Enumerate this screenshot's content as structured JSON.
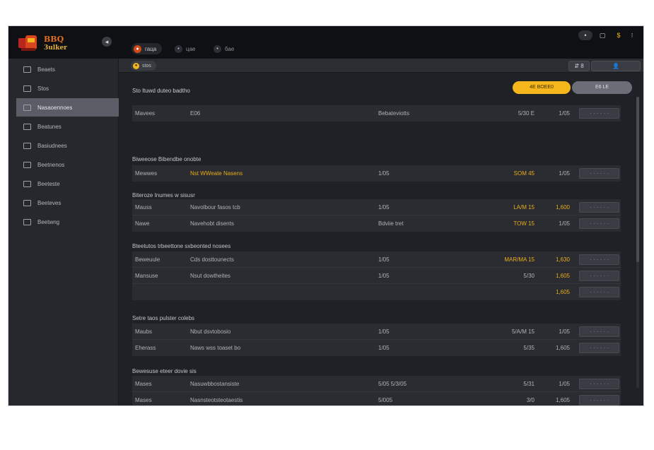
{
  "app": {
    "logo_line1": "BBQ",
    "logo_line2": "3ulker",
    "collapse_glyph": "◂"
  },
  "top_tabs": [
    {
      "label": "гаца",
      "icon": "flame-icon"
    },
    {
      "label": "цае",
      "icon": "dot-icon"
    },
    {
      "label": "бае",
      "icon": "dot-icon"
    }
  ],
  "window_controls": {
    "notif_count": "•",
    "win1": "▢",
    "win2": "$",
    "win3": "⁝"
  },
  "sidebar": {
    "items": [
      {
        "label": "Beaets",
        "icon": "grid-icon"
      },
      {
        "label": "Stos",
        "icon": "square-icon"
      },
      {
        "label": "Nasaoennoes",
        "icon": "square-icon"
      },
      {
        "label": "Beatunes",
        "icon": "table-icon"
      },
      {
        "label": "Basiudnees",
        "icon": "bag-icon"
      },
      {
        "label": "Beetnenos",
        "icon": "list-icon"
      },
      {
        "label": "Beeteste",
        "icon": "sliders-icon"
      },
      {
        "label": "Beeteves",
        "icon": "box-icon"
      },
      {
        "label": "Beetwng",
        "icon": "file-icon"
      }
    ],
    "active_index": 2
  },
  "subbar": {
    "chip_label": "stos",
    "chip_icon": "coin-icon",
    "btn1": "⇵ 8",
    "btn2": "👤"
  },
  "main": {
    "title": "Sto ltuwd duteo badtho",
    "primary_button": "4E BOEE0",
    "secondary_button": "E6 LE",
    "sections": [
      {
        "label": "",
        "rows": [
          {
            "c1": "Mavees",
            "c2": "E06",
            "c3": "Bebateviotts",
            "c4": "5/30 E",
            "c5": "1/05",
            "act": "· · · · · ·"
          }
        ]
      },
      {
        "label": "Biweeose Bibendbe onobte",
        "rows": [
          {
            "c1": "Mewwes",
            "c2": "Nst WWeate Nasens",
            "c3": "1/05",
            "c4": "SOM 45",
            "c5": "1/05",
            "act": "· · · · · ·",
            "highlight": [
              1,
              3
            ]
          }
        ]
      },
      {
        "label": "Biteroze Inumes w sisusr",
        "rows": [
          {
            "c1": "Mauss",
            "c2": "Navolbour fasos tcb",
            "c3": "1/05",
            "c4": "LA/M 15",
            "c5": "1,600",
            "act": "· · · · · ·",
            "highlight": [
              3,
              4
            ]
          },
          {
            "c1": "Nawe",
            "c2": "Navehobt disents",
            "c3": "Bdviie tret",
            "c4": "TOW 15",
            "c5": "1/05",
            "act": "· · · · · ·",
            "highlight": [
              3
            ]
          }
        ]
      },
      {
        "label": "Bteetutos trbeettone sxbeonted nosees",
        "rows": [
          {
            "c1": "Beweuule",
            "c2": "Cds dosttounects",
            "c3": "1/05",
            "c4": "MAR/MA 15",
            "c5": "1,630",
            "act": "· · · · · ·",
            "highlight": [
              3,
              4
            ]
          },
          {
            "c1": "Mansuse",
            "c2": "Nsut dowtheites",
            "c3": "1/05",
            "c4": "5/30",
            "c5": "1,605",
            "act": "· · · · · ·",
            "highlight": [
              4
            ]
          },
          {
            "c1": "",
            "c2": "",
            "c3": "",
            "c4": "",
            "c5": "1,605",
            "act": "· · · · · ·",
            "highlight": [
              4
            ]
          }
        ]
      },
      {
        "label": "Setre taos pulster colebs",
        "rows": [
          {
            "c1": "Maubs",
            "c2": "Nbut dsvtobosio",
            "c3": "1/05",
            "c4": "5/A/M 15",
            "c5": "1/05",
            "act": "· · · · · ·"
          },
          {
            "c1": "Eherass",
            "c2": "Naws wss toaset bo",
            "c3": "1/05",
            "c4": "5/35",
            "c5": "1,605",
            "act": "· · · · · ·"
          }
        ]
      },
      {
        "label": "Bewesuse eteer dovie sis",
        "rows": [
          {
            "c1": "Mases",
            "c2": "Nasuwbbostansiste",
            "c3": "5/05 5/3/05",
            "c4": "5/31",
            "c5": "1/05",
            "act": "· · · · · ·"
          },
          {
            "c1": "Mases",
            "c2": "Nasnsteotsteotaestis",
            "c3": "5/005",
            "c4": "3/0",
            "c5": "1,605",
            "act": "· · · · · ·"
          }
        ]
      }
    ]
  }
}
